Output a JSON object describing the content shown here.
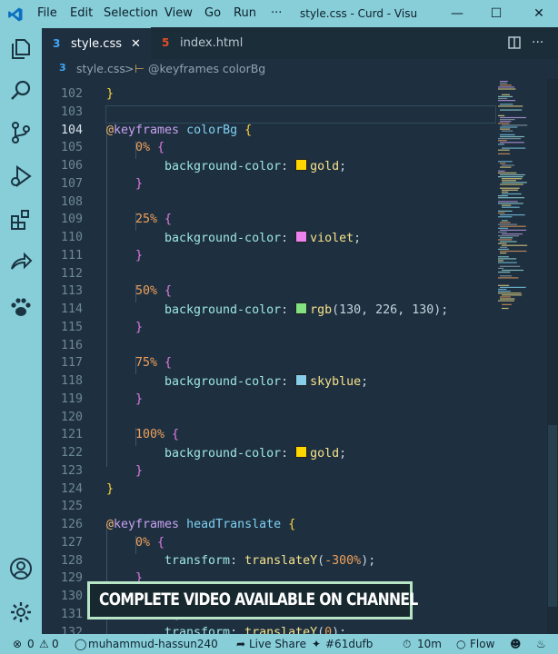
{
  "titlebar": {
    "menu": [
      "File",
      "Edit",
      "Selection",
      "View",
      "Go",
      "Run",
      "···"
    ],
    "title": "style.css - Curd - Visual St..."
  },
  "tabs": [
    {
      "label": "style.css",
      "icon": "css-file-icon",
      "active": true
    },
    {
      "label": "index.html",
      "icon": "html-file-icon",
      "active": false
    }
  ],
  "breadcrumb": {
    "file": "style.css",
    "sep": ">",
    "symbol": "@keyframes colorBg"
  },
  "editor": {
    "current_line": "104",
    "lines": [
      {
        "n": "102",
        "text": "}"
      },
      {
        "n": "103",
        "text": ""
      },
      {
        "n": "104",
        "text": "@keyframes colorBg {"
      },
      {
        "n": "105",
        "text": "0% {"
      },
      {
        "n": "106",
        "text": "background-color: gold;"
      },
      {
        "n": "107",
        "text": "}"
      },
      {
        "n": "108",
        "text": ""
      },
      {
        "n": "109",
        "text": "25% {"
      },
      {
        "n": "110",
        "text": "background-color: violet;"
      },
      {
        "n": "111",
        "text": "}"
      },
      {
        "n": "112",
        "text": ""
      },
      {
        "n": "113",
        "text": "50% {"
      },
      {
        "n": "114",
        "text": "background-color: rgb(130, 226, 130);"
      },
      {
        "n": "115",
        "text": "}"
      },
      {
        "n": "116",
        "text": ""
      },
      {
        "n": "117",
        "text": "75% {"
      },
      {
        "n": "118",
        "text": "background-color: skyblue;"
      },
      {
        "n": "119",
        "text": "}"
      },
      {
        "n": "120",
        "text": ""
      },
      {
        "n": "121",
        "text": "100% {"
      },
      {
        "n": "122",
        "text": "background-color: gold;"
      },
      {
        "n": "123",
        "text": "}"
      },
      {
        "n": "124",
        "text": "}"
      },
      {
        "n": "125",
        "text": ""
      },
      {
        "n": "126",
        "text": "@keyframes headTranslate {"
      },
      {
        "n": "127",
        "text": "0% {"
      },
      {
        "n": "128",
        "text": "transform: translateY(-300%);"
      },
      {
        "n": "129",
        "text": "}"
      },
      {
        "n": "130",
        "text": ""
      },
      {
        "n": "131",
        "text": "100% {"
      },
      {
        "n": "132",
        "text": "transform: translateY(0);"
      }
    ],
    "swatches": {
      "gold": "#ffd700",
      "violet": "#ee82ee",
      "rgb": "#82e282",
      "skyblue": "#87ceeb"
    }
  },
  "statusbar": {
    "errors": "0",
    "warnings": "0",
    "account": "muhammud-hassun240",
    "live_share": "Live Share",
    "commit": "#61dufb",
    "time": "10m",
    "flow": "Flow"
  },
  "banner": {
    "text": "COMPLETE VIDEO AVAILABLE ON CHANNEL"
  },
  "colors": {
    "chrome": "#87ced9",
    "editor_bg": "#1e3040"
  }
}
